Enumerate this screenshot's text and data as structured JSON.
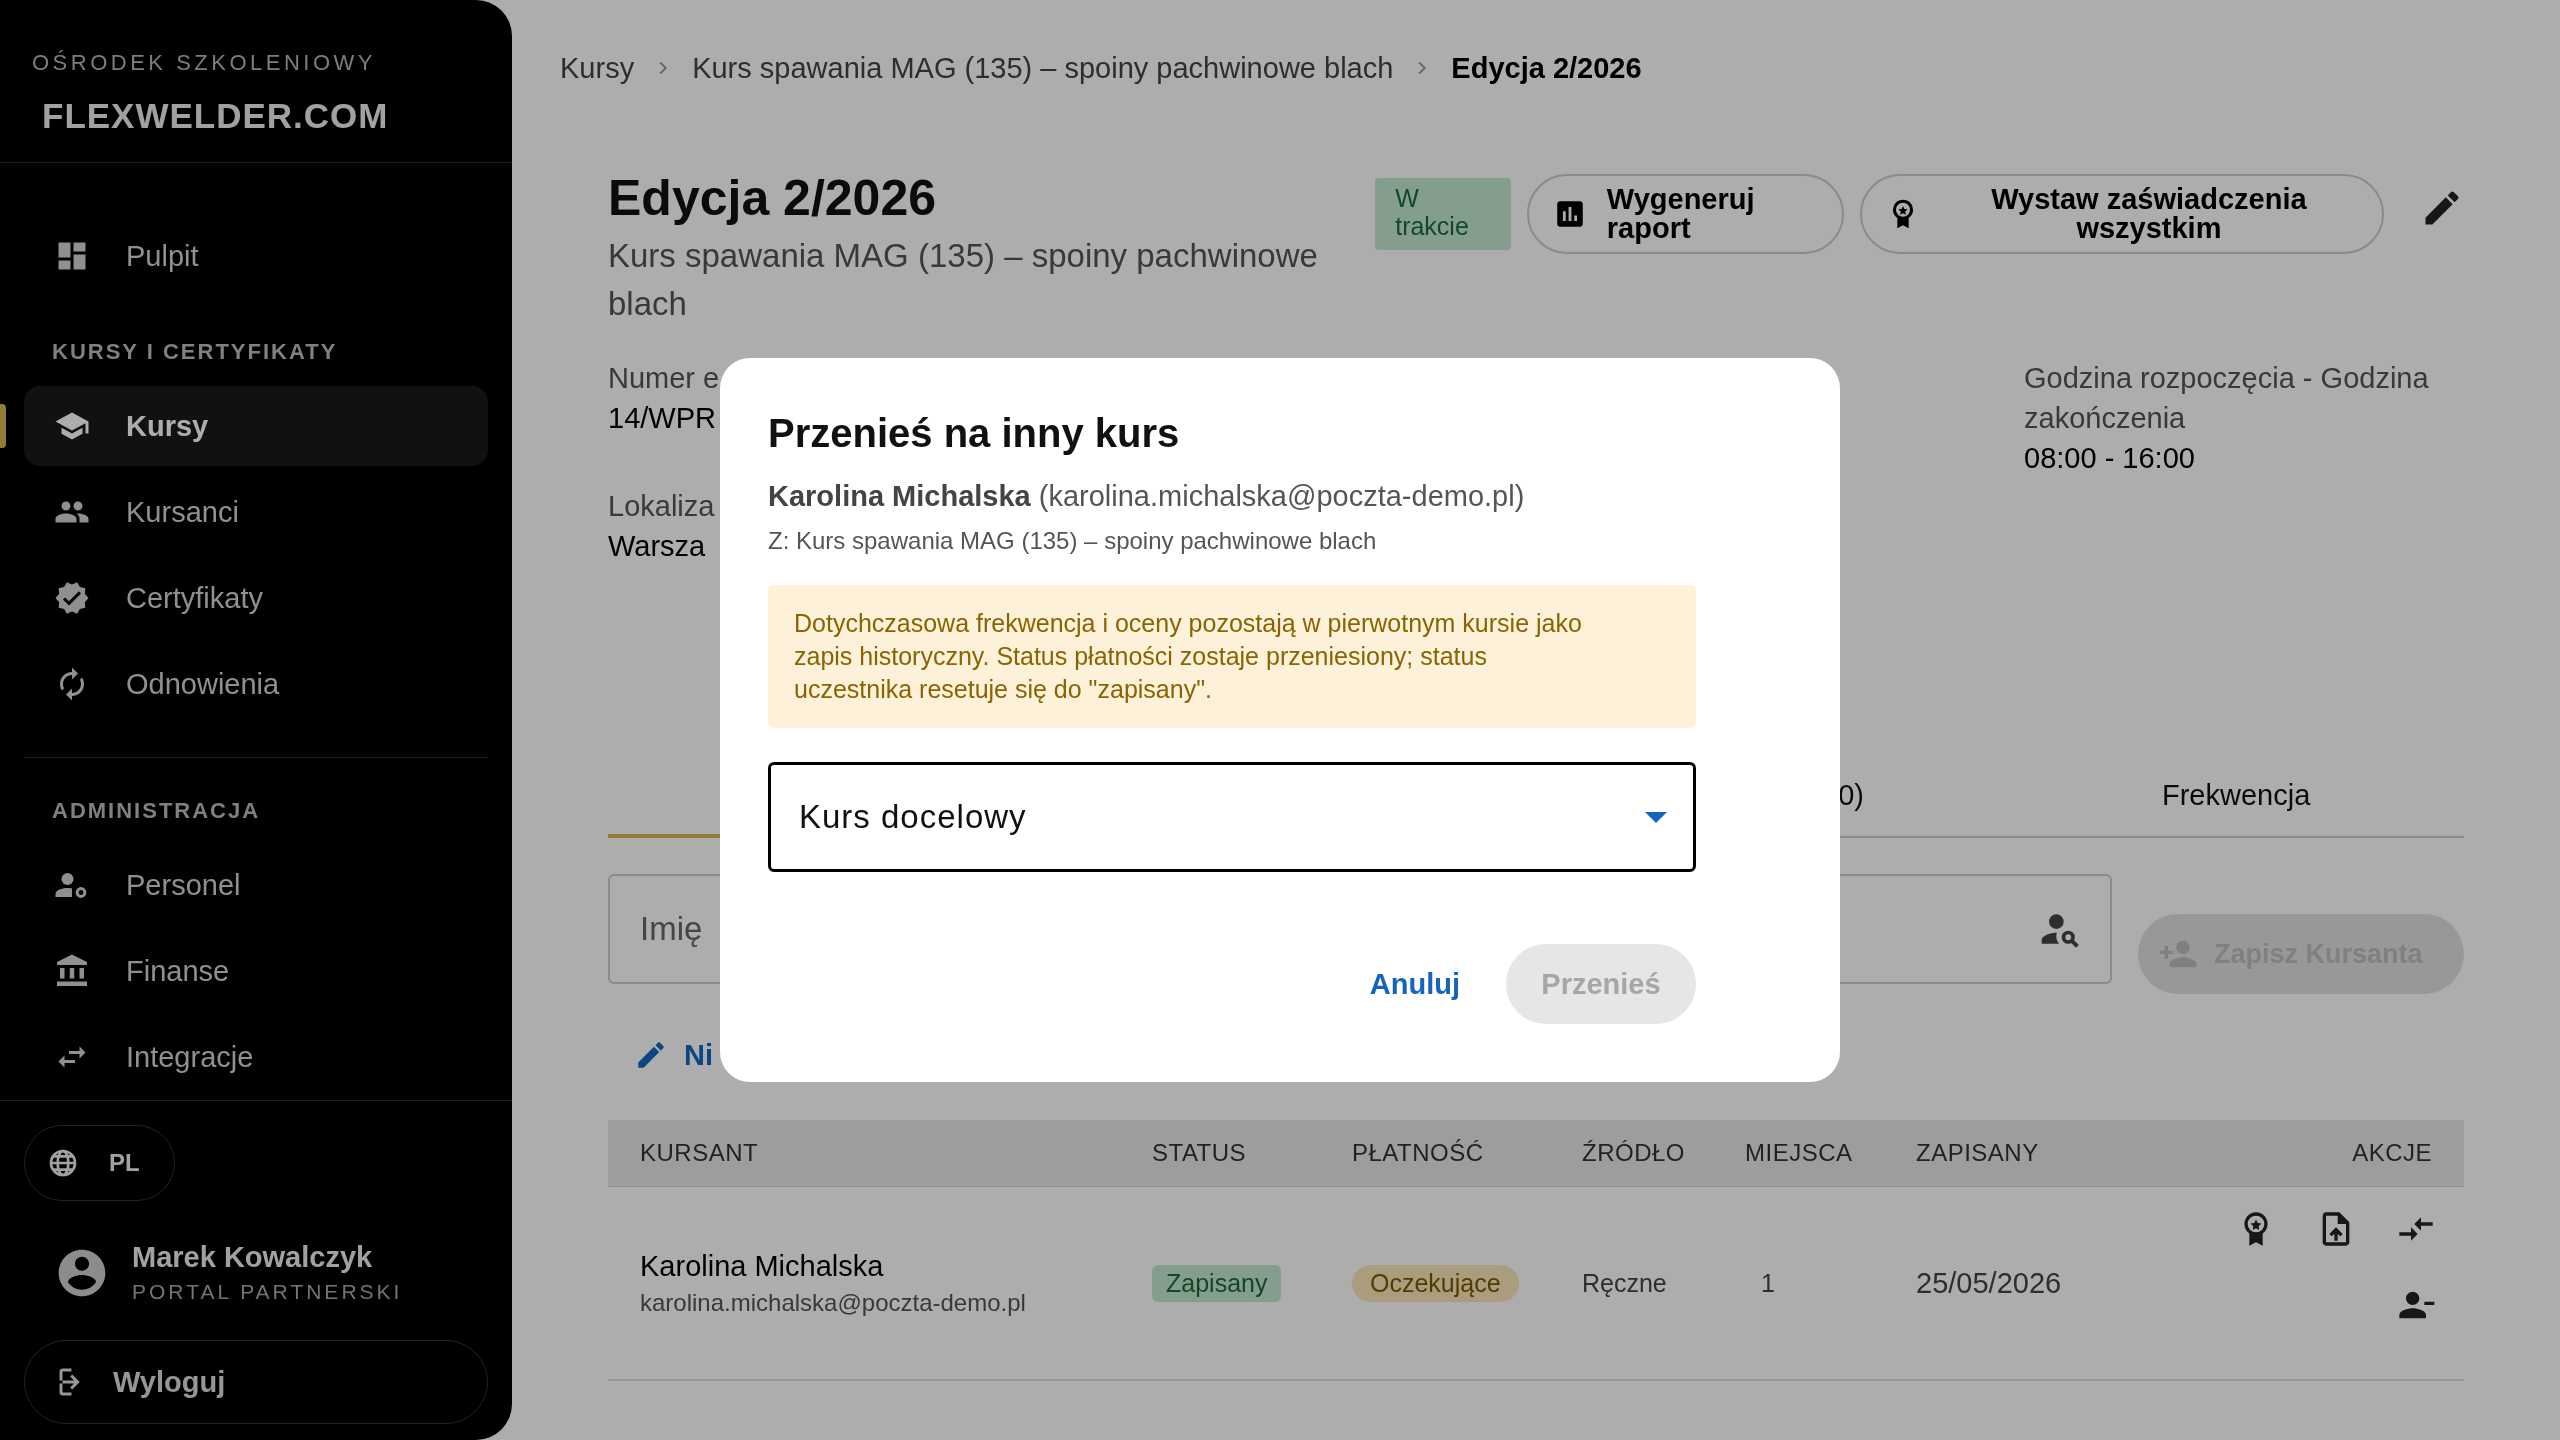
{
  "sidebar": {
    "org_label": "OŚRODEK SZKOLENIOWY",
    "logo": "FLEXWELDER.COM",
    "sections": [
      {
        "items": [
          {
            "label": "Pulpit",
            "selected": false
          }
        ]
      },
      {
        "title": "KURSY I CERTYFIKATY",
        "items": [
          {
            "label": "Kursy",
            "selected": true
          },
          {
            "label": "Kursanci",
            "selected": false
          },
          {
            "label": "Certyfikaty",
            "selected": false
          },
          {
            "label": "Odnowienia",
            "selected": false
          }
        ]
      },
      {
        "title": "ADMINISTRACJA",
        "items": [
          {
            "label": "Personel",
            "selected": false
          },
          {
            "label": "Finanse",
            "selected": false
          },
          {
            "label": "Integracje",
            "selected": false
          }
        ]
      }
    ],
    "language": "PL",
    "user": {
      "name": "Marek Kowalczyk",
      "role": "PORTAL PARTNERSKI"
    },
    "logout": "Wyloguj"
  },
  "breadcrumb": [
    {
      "label": "Kursy",
      "current": false
    },
    {
      "label": "Kurs spawania MAG (135) – spoiny pachwinowe blach",
      "current": false
    },
    {
      "label": "Edycja 2/2026",
      "current": true
    }
  ],
  "header": {
    "title": "Edycja 2/2026",
    "subtitle": "Kurs spawania MAG (135) – spoiny pachwinowe blach",
    "status": "W trakcie",
    "actions": [
      "Wygeneruj raport",
      "Wystaw zaświadczenia wszystkim"
    ]
  },
  "details": [
    {
      "label": "Numer e",
      "value": "14/WPR"
    },
    {
      "label": "Lokaliza",
      "value": "Warsza"
    },
    {
      "label": "Godzina rozpoczęcia - Godzina zakończenia",
      "value": "08:00 - 16:00"
    }
  ],
  "tabs": [
    {
      "selected": true
    },
    {
      "label": "0)",
      "selected": false
    },
    {
      "label": "Frekwencja",
      "selected": false
    }
  ],
  "search": {
    "placeholder": "Imię"
  },
  "enroll_button": {
    "label": "Zapisz Kursanta",
    "disabled": true
  },
  "edit_link": "Ni",
  "table": {
    "columns": [
      "KURSANT",
      "STATUS",
      "PŁATNOŚĆ",
      "ŹRÓDŁO",
      "MIEJSCA",
      "ZAPISANY",
      "AKCJE"
    ],
    "rows": [
      {
        "name": "Karolina Michalska",
        "email": "karolina.michalska@poczta-demo.pl",
        "status": "Zapisany",
        "payment": "Oczekujące",
        "source": "Ręczne",
        "seats": "1",
        "enrolled": "25/05/2026"
      }
    ]
  },
  "dialog": {
    "title": "Przenieś na inny kurs",
    "student": "**Karolina Michalska** (karolina.michalska@poczta-demo.pl)",
    "source": "Z: Kurs spawania MAG (135) – spoiny pachwinowe blach",
    "warning": "Dotychczasowa frekwencja i oceny pozostają w pierwotnym kursie jako zapis historyczny. Status płatności zostaje przeniesiony; status uczestnika resetuje się do \"zapisany\".",
    "select_label": "Kurs docelowy",
    "cancel": "Anuluj",
    "confirm": {
      "label": "Przenieś",
      "disabled": true
    }
  }
}
